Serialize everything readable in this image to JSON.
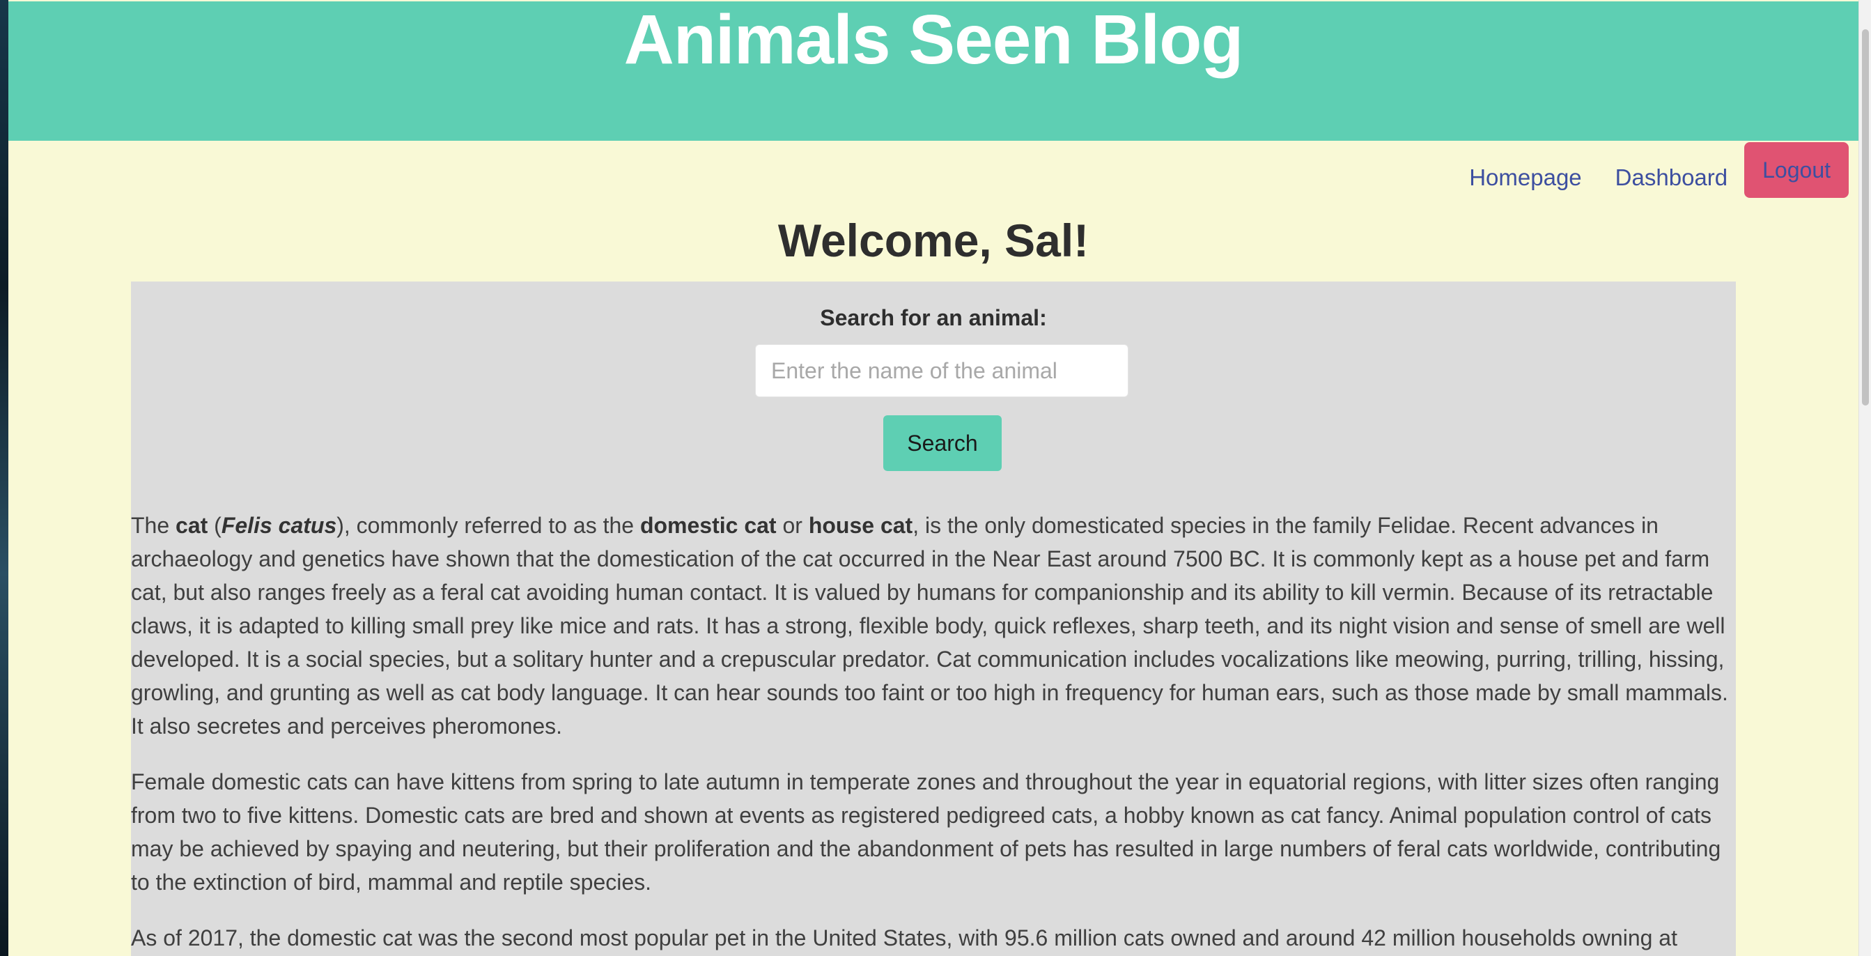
{
  "header": {
    "title": "Animals Seen Blog"
  },
  "nav": {
    "homepage": "Homepage",
    "dashboard": "Dashboard",
    "logout": "Logout"
  },
  "welcome": "Welcome, Sal!",
  "search": {
    "label": "Search for an animal:",
    "placeholder": "Enter the name of the animal",
    "button": "Search"
  },
  "article": {
    "p1": {
      "t1": "The ",
      "b1": "cat",
      "t2": " (",
      "bi1": "Felis catus",
      "t3": "), commonly referred to as the ",
      "b2": "domestic cat",
      "t4": " or ",
      "b3": "house cat",
      "t5": ", is the only domesticated species in the family Felidae. Recent advances in archaeology and genetics have shown that the domestication of the cat occurred in the Near East around 7500 BC. It is commonly kept as a house pet and farm cat, but also ranges freely as a feral cat avoiding human contact. It is valued by humans for companionship and its ability to kill vermin. Because of its retractable claws, it is adapted to killing small prey like mice and rats. It has a strong, flexible body, quick reflexes, sharp teeth, and its night vision and sense of smell are well developed. It is a social species, but a solitary hunter and a crepuscular predator. Cat communication includes vocalizations like meowing, purring, trilling, hissing, growling, and grunting as well as cat body language. It can hear sounds too faint or too high in frequency for human ears, such as those made by small mammals. It also secretes and perceives pheromones."
    },
    "p2": "Female domestic cats can have kittens from spring to late autumn in temperate zones and throughout the year in equatorial regions, with litter sizes often ranging from two to five kittens. Domestic cats are bred and shown at events as registered pedigreed cats, a hobby known as cat fancy. Animal population control of cats may be achieved by spaying and neutering, but their proliferation and the abandonment of pets has resulted in large numbers of feral cats worldwide, contributing to the extinction of bird, mammal and reptile species.",
    "p3": "As of 2017, the domestic cat was the second most popular pet in the United States, with 95.6 million cats owned and around 42 million households owning at"
  }
}
